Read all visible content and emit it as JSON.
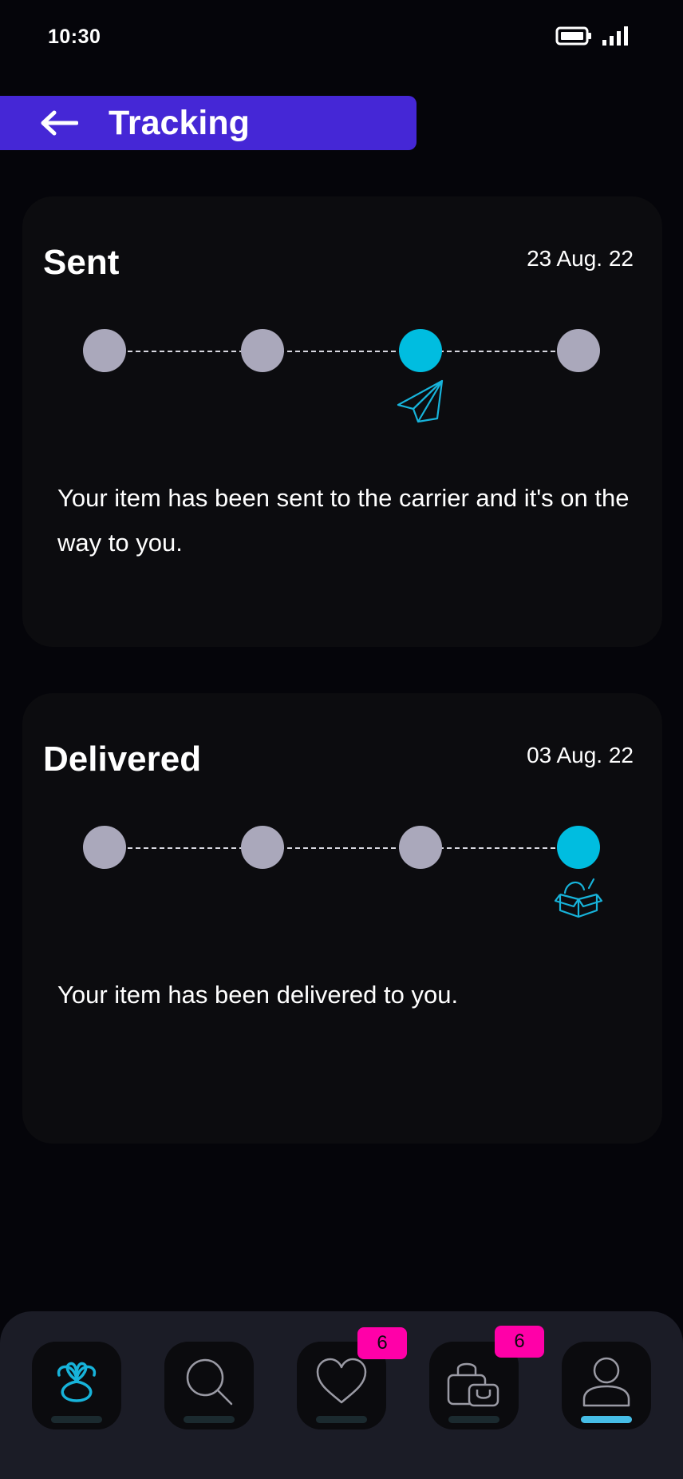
{
  "status_bar": {
    "time": "10:30",
    "icons": [
      "battery-icon",
      "signal-icon"
    ]
  },
  "header": {
    "back_icon": "arrow-left-icon",
    "title": "Tracking",
    "background_color": "#4527d6"
  },
  "cards": [
    {
      "title": "Sent",
      "date": "23 Aug. 22",
      "steps_total": 4,
      "active_step": 3,
      "step_icon": "paper-plane-icon",
      "message": "Your item has been sent to the carrier and it's on the way to you."
    },
    {
      "title": "Delivered",
      "date": "03 Aug. 22",
      "steps_total": 4,
      "active_step": 4,
      "step_icon": "open-box-icon",
      "message": "Your item has been delivered to you."
    }
  ],
  "bottom_nav": {
    "items": [
      {
        "icon": "home-logo-icon",
        "active": false
      },
      {
        "icon": "search-icon",
        "active": false
      },
      {
        "icon": "heart-icon",
        "badge": "6",
        "active": false
      },
      {
        "icon": "shopping-bag-icon",
        "badge": "6",
        "active": false
      },
      {
        "icon": "profile-icon",
        "active": true
      }
    ]
  },
  "colors": {
    "background": "#05050a",
    "card": "#0c0c0f",
    "accent": "#00bde0",
    "step_inactive": "#aaa8bb",
    "badge": "#ff00a8",
    "nav_bar": "#1b1c26"
  }
}
